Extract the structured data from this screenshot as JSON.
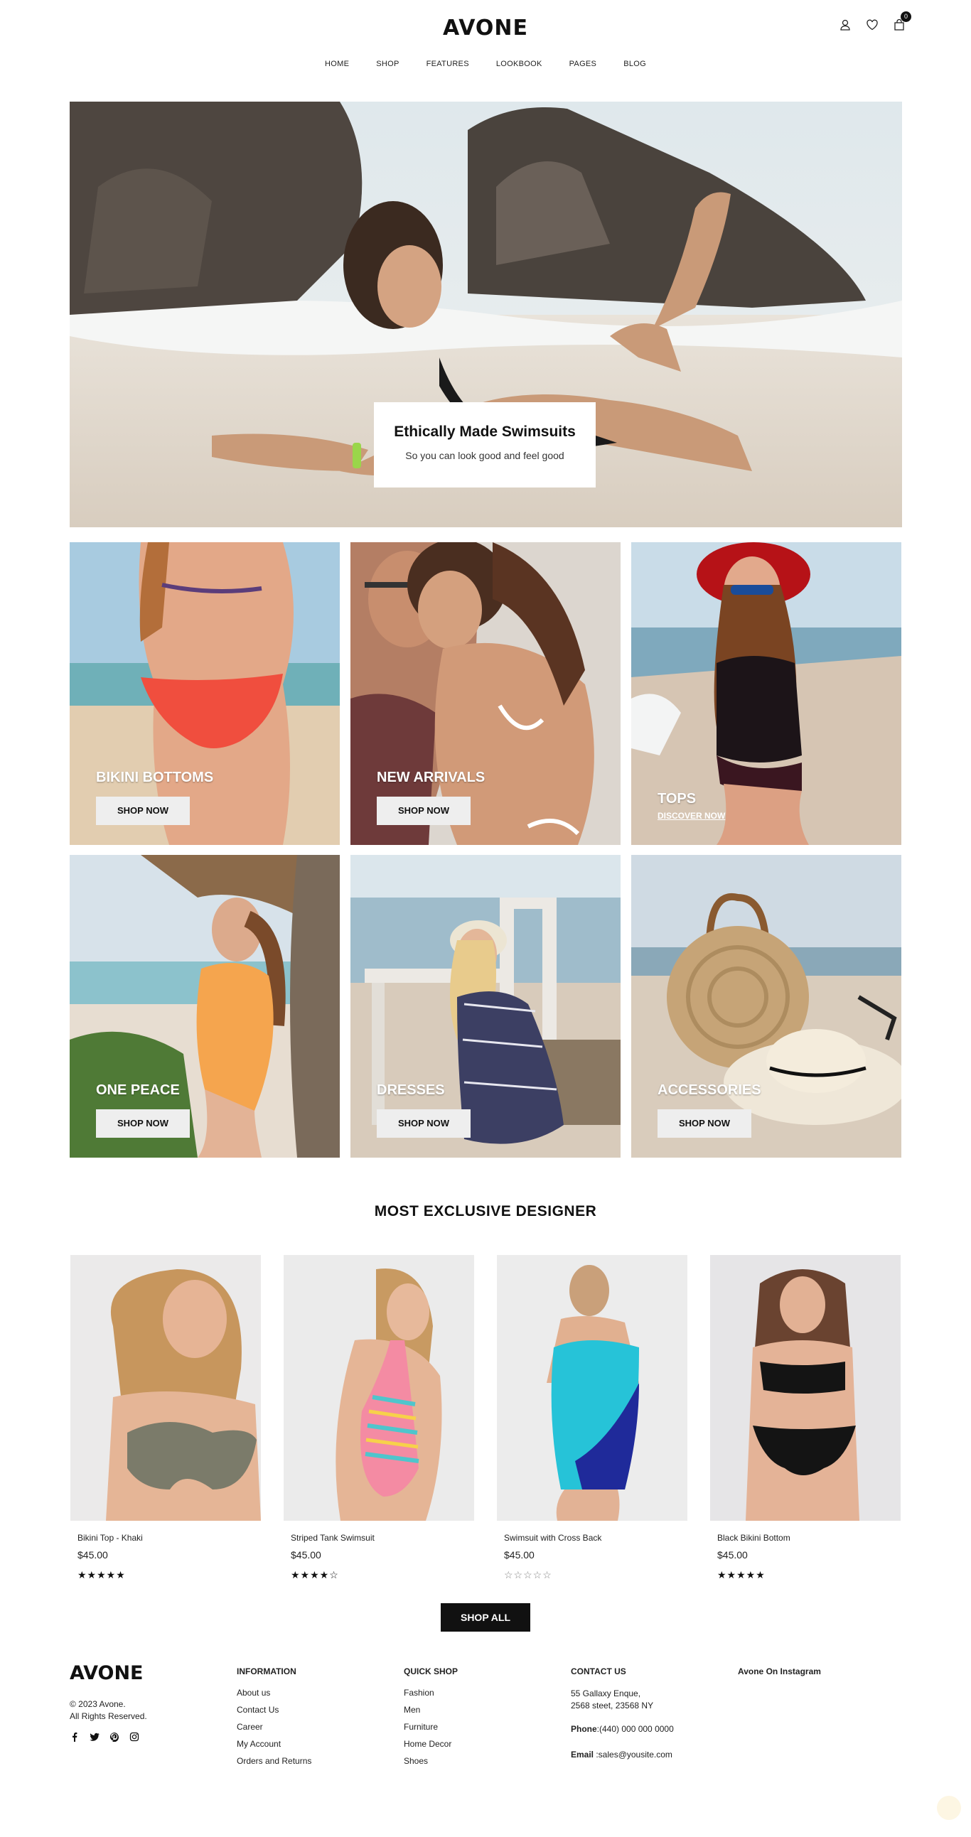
{
  "header": {
    "logo": "AVONE",
    "cart_count": "0",
    "nav": [
      "HOME",
      "SHOP",
      "FEATURES",
      "LOOKBOOK",
      "PAGES",
      "BLOG"
    ]
  },
  "hero": {
    "title": "Ethically Made Swimsuits",
    "subtitle": "So you can look good and feel good"
  },
  "categories": [
    {
      "title": "BIKINI BOTTOMS",
      "cta": "SHOP NOW"
    },
    {
      "title": "NEW ARRIVALS",
      "cta": "SHOP NOW"
    },
    {
      "title": "TOPS",
      "cta": "DISCOVER NOW"
    },
    {
      "title": "ONE PEACE",
      "cta": "SHOP NOW"
    },
    {
      "title": "DRESSES",
      "cta": "SHOP NOW"
    },
    {
      "title": "ACCESSORIES",
      "cta": "SHOP NOW"
    }
  ],
  "products_section": {
    "title": "MOST EXCLUSIVE DESIGNER",
    "shop_all": "SHOP ALL",
    "items": [
      {
        "name": "Bikini Top - Khaki",
        "price": "$45.00",
        "rating": 5
      },
      {
        "name": "Striped Tank Swimsuit",
        "price": "$45.00",
        "rating": 4
      },
      {
        "name": "Swimsuit with Cross Back",
        "price": "$45.00",
        "rating": 0
      },
      {
        "name": "Black Bikini Bottom",
        "price": "$45.00",
        "rating": 5
      }
    ]
  },
  "footer": {
    "logo": "AVONE",
    "copyright_line1": "© 2023 Avone.",
    "copyright_line2": "All Rights Reserved.",
    "information": {
      "title": "INFORMATION",
      "links": [
        "About us",
        "Contact Us",
        "Career",
        "My Account",
        "Orders and Returns"
      ]
    },
    "quick_shop": {
      "title": "QUICK SHOP",
      "links": [
        "Fashion",
        "Men",
        "Furniture",
        "Home Decor",
        "Shoes"
      ]
    },
    "contact": {
      "title": "CONTACT US",
      "address1": "55 Gallaxy Enque,",
      "address2": "2568 steet, 23568 NY",
      "phone_label": "Phone",
      "phone": ":(440) 000 000 0000",
      "email_label": "Email",
      "email": " :sales@yousite.com"
    },
    "instagram_title": "Avone On Instagram"
  }
}
